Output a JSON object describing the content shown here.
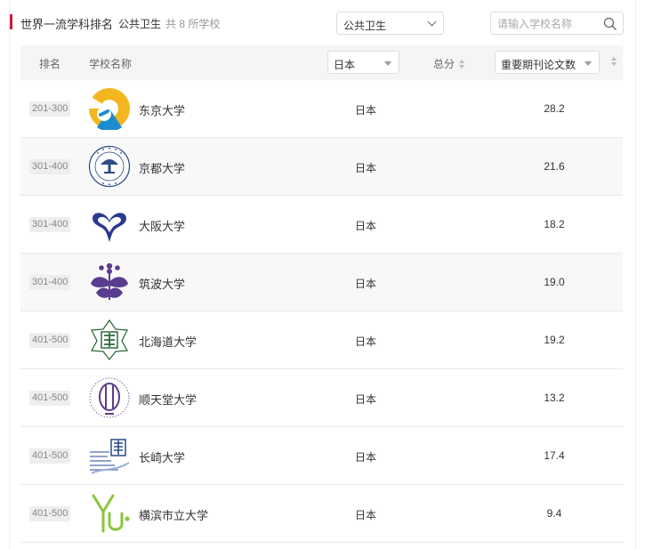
{
  "header": {
    "title": "世界一流学科排名",
    "subject": "公共卫生",
    "count_text": "共 8 所学校",
    "accent_color": "#c81e3c"
  },
  "filters": {
    "subject_select": "公共卫生",
    "search_placeholder": "请输入学校名称"
  },
  "table": {
    "headers": {
      "rank": "排名",
      "name": "学校名称",
      "country_select": "日本",
      "total": "总分",
      "indicator_select": "重要期刊论文数"
    },
    "rows": [
      {
        "rank": "201-300",
        "name": "东京大学",
        "country": "日本",
        "score": "28.2",
        "logo": "tokyo-ginkgo-logo"
      },
      {
        "rank": "301-400",
        "name": "京都大学",
        "country": "日本",
        "score": "21.6",
        "logo": "kyoto-seal-logo"
      },
      {
        "rank": "301-400",
        "name": "大阪大学",
        "country": "日本",
        "score": "18.2",
        "logo": "osaka-icho-logo"
      },
      {
        "rank": "301-400",
        "name": "筑波大学",
        "country": "日本",
        "score": "19.0",
        "logo": "tsukuba-kiri-logo"
      },
      {
        "rank": "401-500",
        "name": "北海道大学",
        "country": "日本",
        "score": "19.2",
        "logo": "hokkaido-star-logo"
      },
      {
        "rank": "401-500",
        "name": "顺天堂大学",
        "country": "日本",
        "score": "13.2",
        "logo": "juntendo-logo"
      },
      {
        "rank": "401-500",
        "name": "长崎大学",
        "country": "日本",
        "score": "17.4",
        "logo": "nagasaki-logo"
      },
      {
        "rank": "401-500",
        "name": "横滨市立大学",
        "country": "日本",
        "score": "9.4",
        "logo": "yokohama-yu-logo"
      }
    ]
  }
}
